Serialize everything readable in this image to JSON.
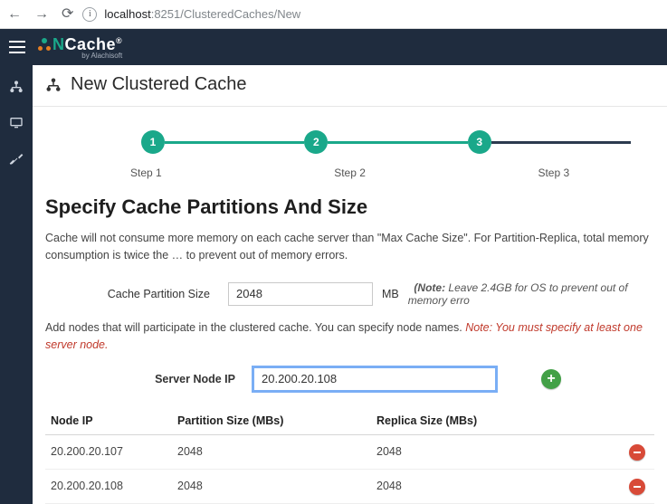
{
  "browser": {
    "url_host": "localhost",
    "url_port_path": ":8251/ClusteredCaches/New"
  },
  "brand": {
    "name_prefix": "N",
    "name_rest": "Cache",
    "reg": "®",
    "byline": "by Alachisoft"
  },
  "page": {
    "title": "New Clustered Cache"
  },
  "stepper": {
    "steps": [
      "1",
      "2",
      "3"
    ],
    "labels": [
      "Step 1",
      "Step 2",
      "Step 3"
    ]
  },
  "section": {
    "heading": "Specify Cache Partitions And Size",
    "desc": "Cache will not consume more memory on each cache server than \"Max Cache Size\". For Partition-Replica, total memory consumption is twice the … to prevent out of memory errors.",
    "partition_label": "Cache Partition Size",
    "partition_value": "2048",
    "unit": "MB",
    "partition_hint_bold": "(Note:",
    "partition_hint_rest": " Leave 2.4GB for OS to prevent out of memory erro",
    "add_nodes_text": "Add nodes that will participate in the clustered cache. You can specify node names. ",
    "add_nodes_note": "Note: You must specify at least one server node.",
    "server_label": "Server Node IP",
    "server_value": "20.200.20.108"
  },
  "table": {
    "headers": [
      "Node IP",
      "Partition Size (MBs)",
      "Replica Size (MBs)",
      ""
    ],
    "rows": [
      {
        "ip": "20.200.20.107",
        "partition": "2048",
        "replica": "2048"
      },
      {
        "ip": "20.200.20.108",
        "partition": "2048",
        "replica": "2048"
      }
    ]
  }
}
